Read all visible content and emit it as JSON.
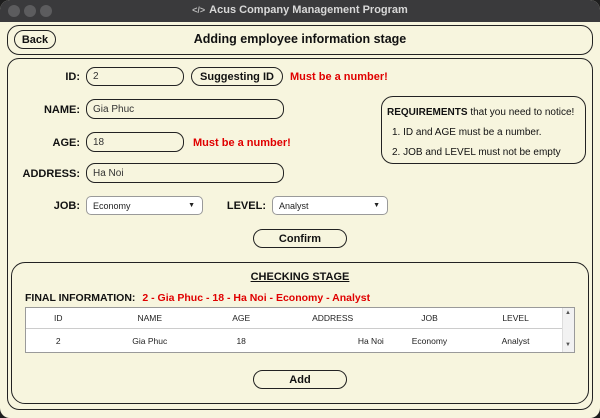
{
  "window": {
    "title": "Acus Company Management Program"
  },
  "header": {
    "back_label": "Back",
    "title": "Adding employee information stage"
  },
  "form": {
    "id": {
      "label": "ID:",
      "value": "2",
      "suggest_label": "Suggesting ID",
      "error": "Must be a number!"
    },
    "name": {
      "label": "NAME:",
      "value": "Gia Phuc"
    },
    "age": {
      "label": "AGE:",
      "value": "18",
      "error": "Must be a number!"
    },
    "address": {
      "label": "ADDRESS:",
      "value": "Ha Noi"
    },
    "job": {
      "label": "JOB:",
      "value": "Economy"
    },
    "level": {
      "label": "LEVEL:",
      "value": "Analyst"
    },
    "confirm_label": "Confirm"
  },
  "requirements": {
    "heading_bold": "REQUIREMENTS",
    "heading_rest": " that you need to notice!",
    "items": [
      "1. ID and AGE must be a number.",
      "2. JOB and LEVEL must not be empty"
    ]
  },
  "checking": {
    "title": "CHECKING STAGE",
    "final_label": "FINAL INFORMATION:",
    "final_value": "2 - Gia Phuc - 18 - Ha Noi - Economy - Analyst",
    "columns": [
      "ID",
      "NAME",
      "AGE",
      "ADDRESS",
      "JOB",
      "LEVEL"
    ],
    "rows": [
      [
        "2",
        "Gia Phuc",
        "18",
        "Ha Noi",
        "Economy",
        "Analyst"
      ]
    ],
    "add_label": "Add"
  },
  "colors": {
    "background": "#f7f5de",
    "error": "#e00000",
    "border": "#222222"
  }
}
